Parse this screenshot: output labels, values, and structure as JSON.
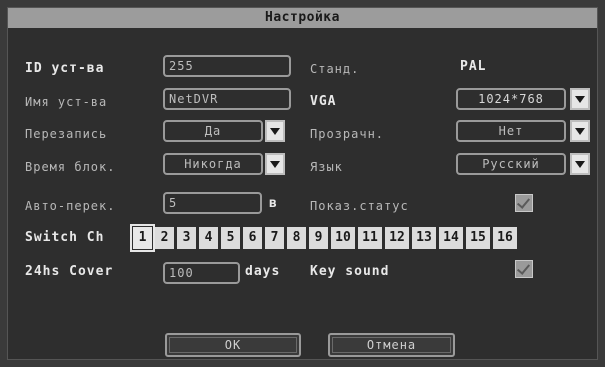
{
  "title": "Настройка",
  "labels": {
    "device_id": "ID уст-ва",
    "device_name": "Имя уст-ва",
    "overwrite": "Перезапись",
    "lock_time": "Время блок.",
    "auto_switch": "Авто-перек.",
    "auto_switch_unit": "в",
    "switch_ch": "Switch Ch",
    "cover_24hs": "24hs Cover",
    "days": "days",
    "standard": "Станд.",
    "vga": "VGA",
    "transparency": "Прозрачн.",
    "language": "Язык",
    "show_status": "Показ.статус",
    "key_sound": "Key sound"
  },
  "values": {
    "device_id": "255",
    "standard": "PAL",
    "device_name": "NetDVR",
    "vga": "1024*768",
    "overwrite": "Да",
    "transparency": "Нет",
    "lock_time": "Никогда",
    "language": "Русский",
    "auto_switch": "5",
    "cover_24hs": "100",
    "show_status_checked": true,
    "key_sound_checked": true,
    "selected_channel": "1"
  },
  "channels": [
    "1",
    "2",
    "3",
    "4",
    "5",
    "6",
    "7",
    "8",
    "9",
    "10",
    "11",
    "12",
    "13",
    "14",
    "15",
    "16"
  ],
  "buttons": {
    "ok": "OK",
    "cancel": "Отмена"
  }
}
